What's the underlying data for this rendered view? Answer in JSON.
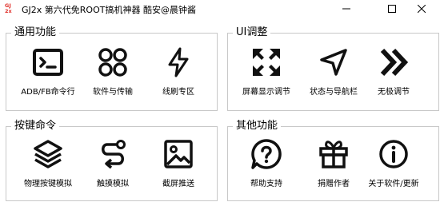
{
  "window": {
    "logo_text": "GJ2x",
    "title": "GJ2x 第六代免ROOT搞机神器  酷安@晨钟酱",
    "buttons": [
      "minimize-icon",
      "maximize-icon",
      "close-icon"
    ]
  },
  "groups": {
    "general": {
      "title": "通用功能",
      "items": [
        {
          "label": "ADB/FB命令行",
          "icon": "terminal-icon"
        },
        {
          "label": "软件与传输",
          "icon": "apps-grid-icon"
        },
        {
          "label": "线刷专区",
          "icon": "lightning-icon"
        }
      ]
    },
    "ui": {
      "title": "UI调整",
      "items": [
        {
          "label": "屏幕显示调节",
          "icon": "expand-arrows-icon"
        },
        {
          "label": "状态与导航栏",
          "icon": "navigation-arrow-icon"
        },
        {
          "label": "无极调节",
          "icon": "double-chevron-right-icon"
        }
      ]
    },
    "keys": {
      "title": "按键命令",
      "items": [
        {
          "label": "物理按键模拟",
          "icon": "layers-icon"
        },
        {
          "label": "触摸模拟",
          "icon": "route-path-icon"
        },
        {
          "label": "截屏推送",
          "icon": "image-icon"
        }
      ]
    },
    "other": {
      "title": "其他功能",
      "items": [
        {
          "label": "帮助支持",
          "icon": "help-chat-icon"
        },
        {
          "label": "捐赠作者",
          "icon": "gift-icon"
        },
        {
          "label": "关于软件/更新",
          "icon": "info-icon"
        }
      ]
    }
  }
}
